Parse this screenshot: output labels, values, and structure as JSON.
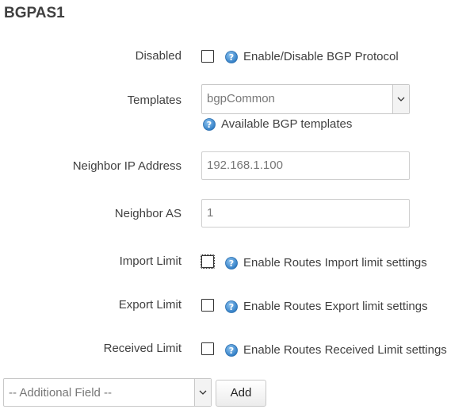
{
  "section": {
    "title": "BGPAS1"
  },
  "fields": {
    "disabled": {
      "label": "Disabled",
      "help": "Enable/Disable BGP Protocol",
      "checked": false
    },
    "templates": {
      "label": "Templates",
      "selected": "bgpCommon",
      "help": "Available BGP templates"
    },
    "neighbor_ip": {
      "label": "Neighbor IP Address",
      "placeholder": "192.168.1.100"
    },
    "neighbor_as": {
      "label": "Neighbor AS",
      "placeholder": "1"
    },
    "import_limit": {
      "label": "Import Limit",
      "help": "Enable Routes Import limit settings",
      "checked": false
    },
    "export_limit": {
      "label": "Export Limit",
      "help": "Enable Routes Export limit settings",
      "checked": false
    },
    "received_limit": {
      "label": "Received Limit",
      "help": "Enable Routes Received Limit settings",
      "checked": false
    }
  },
  "footer": {
    "additional_field": {
      "selected": "-- Additional Field --"
    },
    "add_button": "Add"
  },
  "colors": {
    "help_icon": "#3d8fd1",
    "text": "#404040",
    "placeholder": "#777777"
  }
}
